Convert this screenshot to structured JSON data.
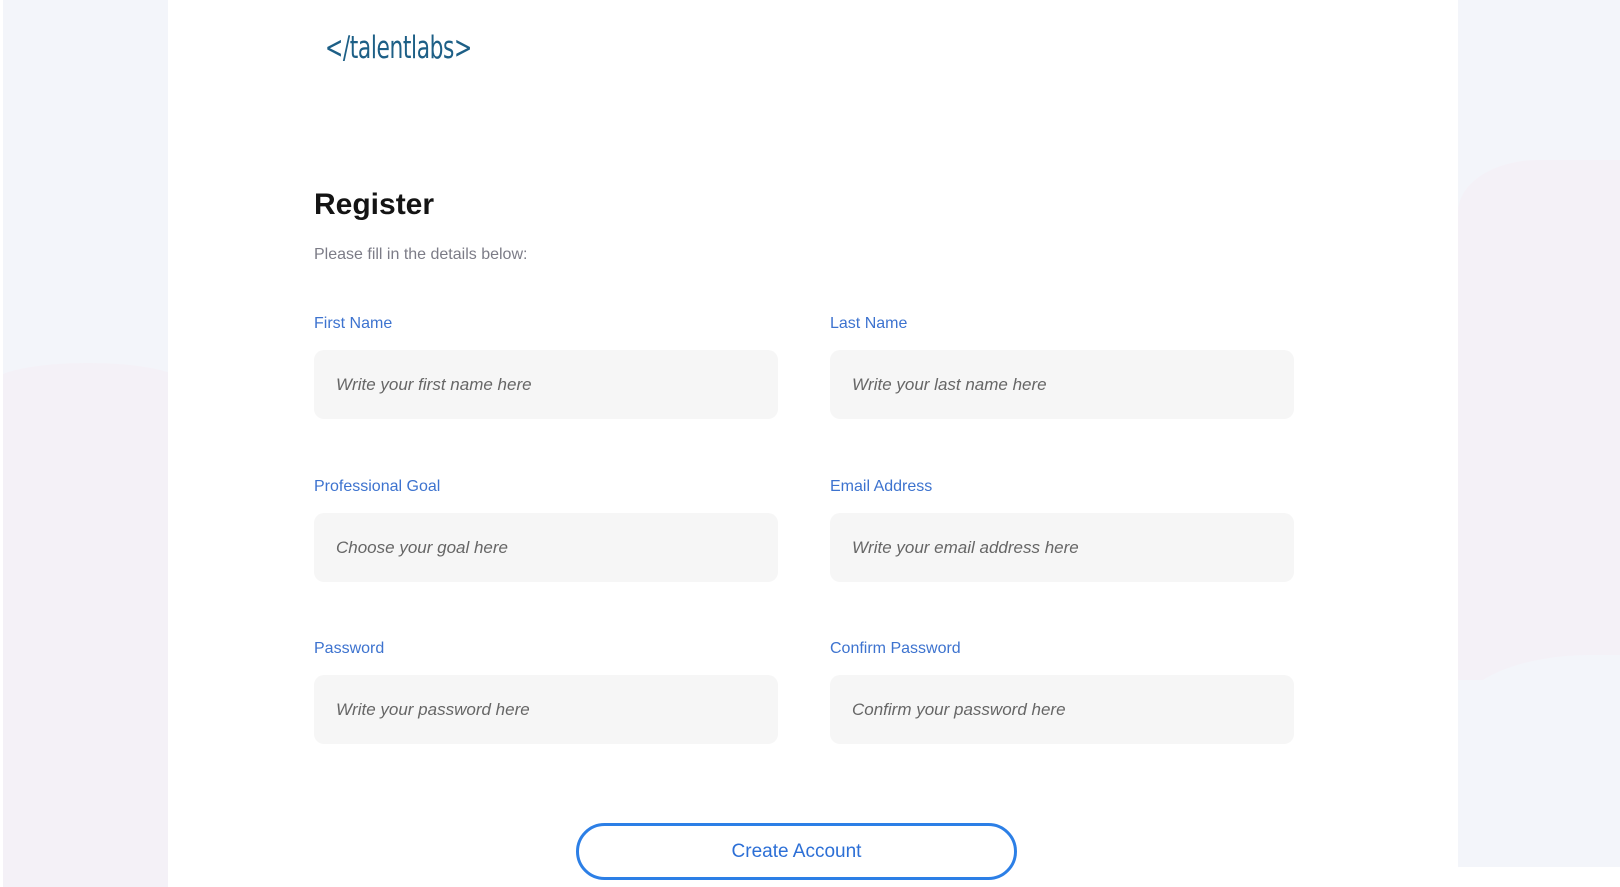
{
  "brand": {
    "logo_text": "</talentlabs>"
  },
  "header": {
    "title": "Register",
    "subtitle": "Please fill in the details below:"
  },
  "form": {
    "first_name": {
      "label": "First Name",
      "placeholder": "Write your first name here"
    },
    "last_name": {
      "label": "Last Name",
      "placeholder": "Write your last name here"
    },
    "professional_goal": {
      "label": "Professional Goal",
      "placeholder": "Choose your goal here"
    },
    "email": {
      "label": "Email Address",
      "placeholder": "Write your email address here"
    },
    "password": {
      "label": "Password",
      "placeholder": "Write your password here"
    },
    "confirm_password": {
      "label": "Confirm Password",
      "placeholder": "Confirm your password here"
    }
  },
  "actions": {
    "create_account_label": "Create Account"
  },
  "colors": {
    "label_blue": "#3d73cf",
    "button_border": "#2c7fe6",
    "logo": "#1d5f86",
    "input_bg": "#f6f6f6",
    "side_bg": "#f3f5fa"
  }
}
